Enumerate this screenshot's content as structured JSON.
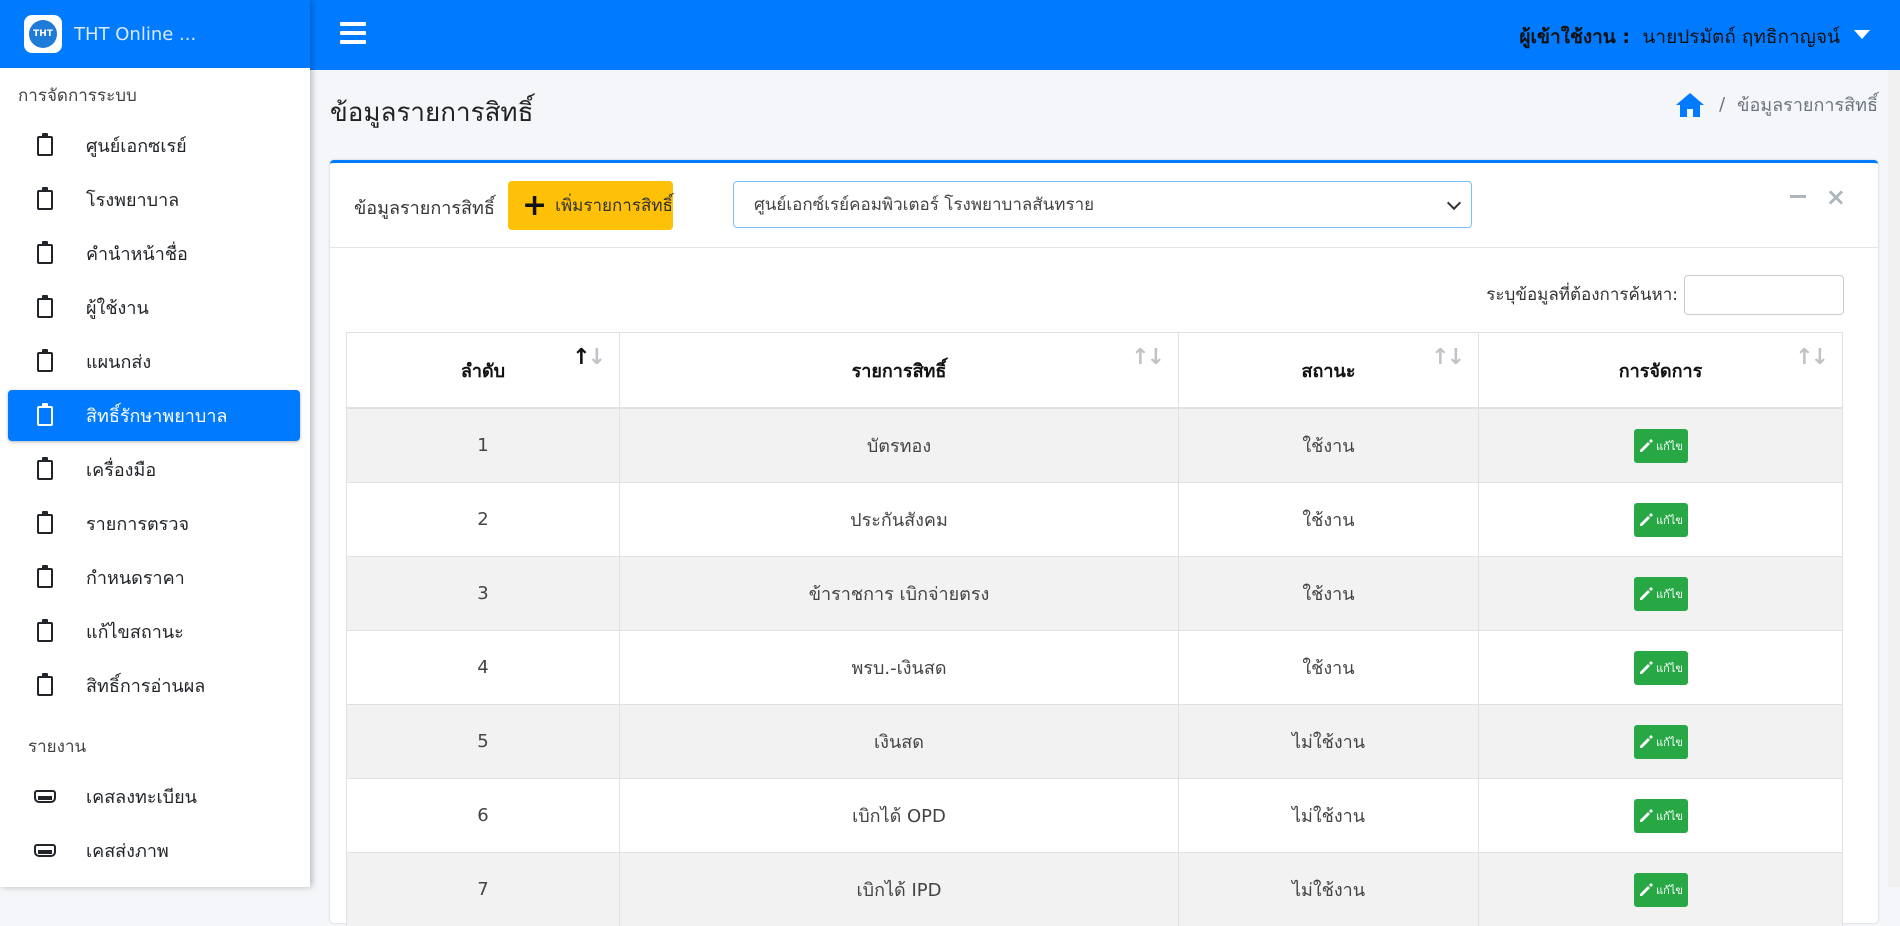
{
  "brand": {
    "name": "THT Online ...",
    "logo_text": "THT"
  },
  "sidebar": {
    "section_admin": "การจัดการระบบ",
    "admin_items": [
      {
        "label": "ศูนย์เอกซเรย์"
      },
      {
        "label": "โรงพยาบาล"
      },
      {
        "label": "คำนำหน้าชื่อ"
      },
      {
        "label": "ผู้ใช้งาน"
      },
      {
        "label": "แผนกส่ง"
      },
      {
        "label": "สิทธิ์รักษาพยาบาล"
      },
      {
        "label": "เครื่องมือ"
      },
      {
        "label": "รายการตรวจ"
      },
      {
        "label": "กำหนดราคา"
      },
      {
        "label": "แก้ไขสถานะ"
      },
      {
        "label": "สิทธิ์การอ่านผล"
      }
    ],
    "section_report": "รายงาน",
    "report_items": [
      {
        "label": "เคสลงทะเบียน"
      },
      {
        "label": "เคสส่งภาพ"
      }
    ]
  },
  "topbar": {
    "user_label": "ผู้เข้าใช้งาน :",
    "user_name": "นายปรมัตถ์ ฤทธิกาญจน์"
  },
  "page": {
    "title": "ข้อมูลรายการสิทธิ์",
    "breadcrumb_current": "ข้อมูลรายการสิทธิ์"
  },
  "card": {
    "title": "ข้อมูลรายการสิทธิ์",
    "add_button": "เพิ่มรายการสิทธิ์",
    "select_value": "ศูนย์เอกซ์เรย์คอมพิวเตอร์ โรงพยาบาลสันทราย",
    "search_label": "ระบุข้อมูลที่ต้องการค้นหา:",
    "search_value": ""
  },
  "table": {
    "headers": [
      "ลำดับ",
      "รายการสิทธิ์",
      "สถานะ",
      "การจัดการ"
    ],
    "edit_label": "แก้ไข",
    "rows": [
      {
        "no": "1",
        "name": "บัตรทอง",
        "status": "ใช้งาน"
      },
      {
        "no": "2",
        "name": "ประกันสังคม",
        "status": "ใช้งาน"
      },
      {
        "no": "3",
        "name": "ข้าราชการ เบิกจ่ายตรง",
        "status": "ใช้งาน"
      },
      {
        "no": "4",
        "name": "พรบ.-เงินสด",
        "status": "ใช้งาน"
      },
      {
        "no": "5",
        "name": "เงินสด",
        "status": "ไม่ใช้งาน"
      },
      {
        "no": "6",
        "name": "เบิกได้ OPD",
        "status": "ไม่ใช้งาน"
      },
      {
        "no": "7",
        "name": "เบิกได้ IPD",
        "status": "ไม่ใช้งาน"
      }
    ]
  },
  "colors": {
    "primary": "#007bff",
    "warning": "#ffc107",
    "success": "#28a745"
  },
  "icons": {
    "nav_admin": "clipboard-icon",
    "nav_report": "inbox-icon",
    "home": "home-icon",
    "edit": "pencil-icon"
  }
}
